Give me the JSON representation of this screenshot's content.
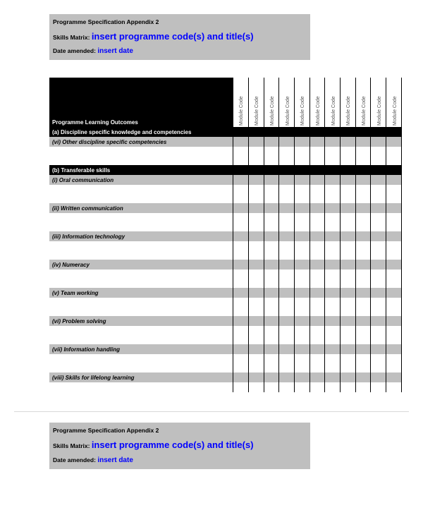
{
  "header": {
    "app_title": "Programme Specification Appendix 2",
    "skills_matrix_label": "Skills Matrix:",
    "skills_matrix_value": "insert programme code(s) and title(s)",
    "date_label": "Date amended:",
    "date_value": "insert date"
  },
  "matrix": {
    "outcomes_label": "Programme Learning Outcomes",
    "col_label": "Module Code",
    "col_count": 11,
    "section_a": "(a) Discipline specific knowledge and competencies",
    "row_a6": "(vi) Other discipline specific competencies",
    "section_b": "(b) Transferable skills",
    "rows_b": [
      "(i) Oral communication",
      "(ii) Written communication",
      "(iii) Information technology",
      "(iv) Numeracy",
      "(v) Team working",
      "(vi) Problem solving",
      "(vii) Information handling",
      "(viii) Skills for lifelong learning"
    ]
  }
}
